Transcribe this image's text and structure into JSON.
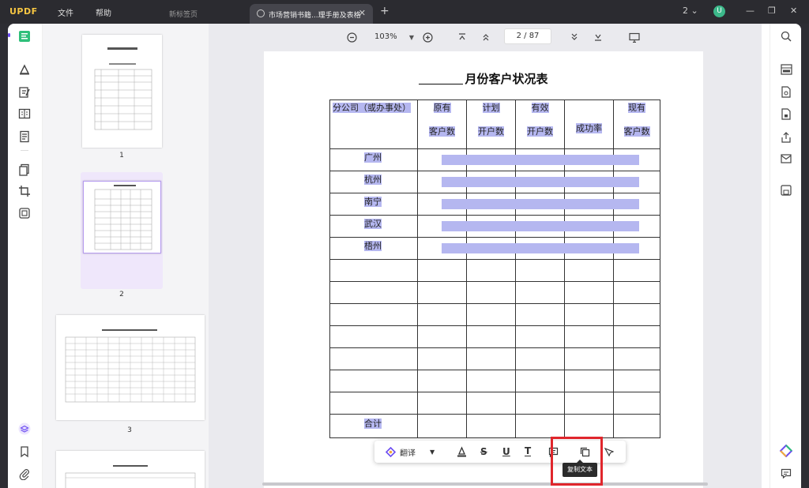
{
  "app": {
    "logo": "UPDF",
    "menu": [
      "文件",
      "帮助"
    ],
    "tab_inactive": "新标签页",
    "tab_active": "市场营销书籍...理手册及表格",
    "window_count": "2",
    "avatar_letter": "U"
  },
  "toolbar": {
    "zoom": "103%",
    "current_page": "2",
    "page_sep": "/",
    "total_pages": "87"
  },
  "thumbnails": [
    {
      "label": "1"
    },
    {
      "label": "2"
    },
    {
      "label": "3"
    }
  ],
  "document": {
    "title": "月份客户状况表",
    "headers": {
      "col1": "分公司（或办事处）",
      "col2_top": "原有",
      "col2_bottom": "客户数",
      "col3_top": "计划",
      "col3_bottom": "开户数",
      "col4_top": "有效",
      "col4_bottom": "开户数",
      "col5": "成功率",
      "col6_top": "现有",
      "col6_bottom": "客户数"
    },
    "rows": [
      "广州",
      "杭州",
      "南宁",
      "武汉",
      "梧州",
      "",
      "",
      "",
      "",
      "",
      "",
      ""
    ],
    "total_label": "合计"
  },
  "float_toolbar": {
    "translate": "翻译",
    "copy_tooltip": "复制文本"
  },
  "colors": {
    "highlight": "#b5b7f0",
    "accent": "#6c4cf1",
    "annotation_box": "#e0262c"
  }
}
